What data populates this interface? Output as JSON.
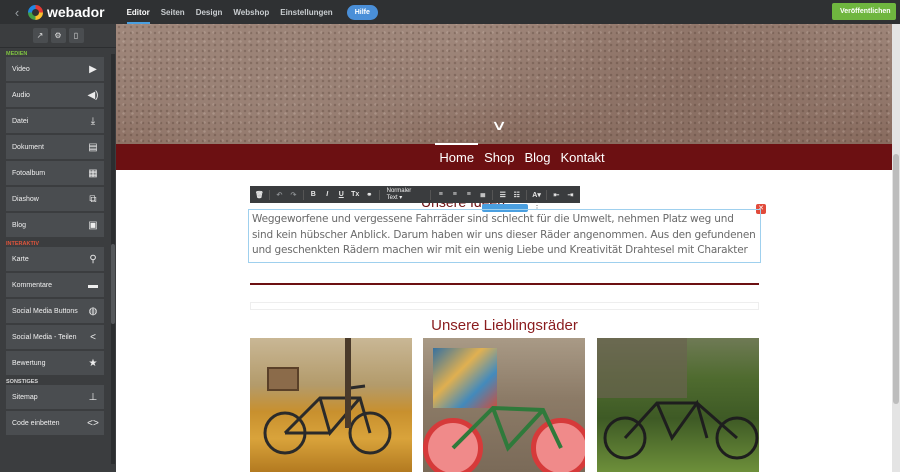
{
  "topbar": {
    "brand": "webador",
    "nav": [
      "Editor",
      "Seiten",
      "Design",
      "Webshop",
      "Einstellungen"
    ],
    "active_nav": "Editor",
    "help_label": "Hilfe",
    "publish_label": "Veröffentlichen",
    "accent_color": "#4a9fe0",
    "publish_color": "#6fb63f"
  },
  "sidebar": {
    "tool_icons": [
      "external-link-icon",
      "gear-icon",
      "mobile-icon"
    ],
    "sections": [
      {
        "label": "MEDIEN",
        "color": "#7fc241",
        "items": [
          {
            "label": "Video",
            "icon": "video-icon"
          },
          {
            "label": "Audio",
            "icon": "speaker-icon"
          },
          {
            "label": "Datei",
            "icon": "download-icon"
          },
          {
            "label": "Dokument",
            "icon": "document-icon"
          },
          {
            "label": "Fotoalbum",
            "icon": "grid-icon"
          },
          {
            "label": "Diashow",
            "icon": "slideshow-icon"
          },
          {
            "label": "Blog",
            "icon": "blog-icon"
          }
        ]
      },
      {
        "label": "INTERAKTIV",
        "color": "#e0553c",
        "items": [
          {
            "label": "Karte",
            "icon": "map-pin-icon"
          },
          {
            "label": "Kommentare",
            "icon": "comment-icon"
          },
          {
            "label": "Social Media Buttons",
            "icon": "globe-icon"
          },
          {
            "label": "Social Media - Teilen",
            "icon": "share-icon"
          },
          {
            "label": "Bewertung",
            "icon": "star-icon"
          }
        ]
      },
      {
        "label": "SONSTIGES",
        "color": "#d8d8d8",
        "items": [
          {
            "label": "Sitemap",
            "icon": "sitemap-icon"
          },
          {
            "label": "Code einbetten",
            "icon": "code-icon"
          }
        ]
      }
    ]
  },
  "site": {
    "menu": [
      "Home",
      "Shop",
      "Blog",
      "Kontakt"
    ],
    "active_menu": "Home",
    "brand_color": "#6c1012",
    "heading_partial": "Unsere Ideen",
    "paragraph": "Weggeworfene und vergessene Fahrräder sind schlecht für die Umwelt, nehmen Platz weg und sind kein hübscher Anblick. Darum haben wir uns dieser Räder angenommen. Aus den gefundenen und geschenkten Rädern machen wir mit ein wenig Liebe und Kreativität Drahtesel mit Charakter",
    "section_title": "Unsere Lieblingsräder",
    "photos": [
      "bicycle-with-crate-photo",
      "red-wheel-bicycle-photo",
      "tandem-bicycle-photo"
    ]
  },
  "format_toolbar": {
    "style_dropdown": "Normaler Text",
    "buttons": [
      "trash-icon",
      "undo-icon",
      "redo-icon",
      "bold-icon",
      "italic-icon",
      "underline-icon",
      "clear-format-icon",
      "link-icon",
      "align-left-icon",
      "align-center-icon",
      "align-right-icon",
      "align-justify-icon",
      "bullet-list-icon",
      "numbered-list-icon",
      "text-color-icon",
      "outdent-icon",
      "indent-icon"
    ]
  }
}
